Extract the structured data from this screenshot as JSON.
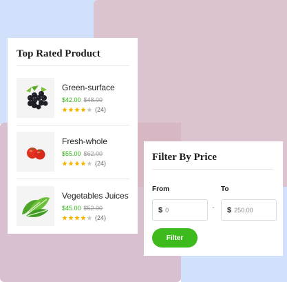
{
  "top_rated": {
    "title": "Top Rated Product",
    "products": [
      {
        "name": "Green-surface",
        "price": "$42.00",
        "old_price": "$48.00",
        "rating": 4,
        "max_rating": 5,
        "reviews": "(24)",
        "icon": "blackberry-icon"
      },
      {
        "name": "Fresh-whole",
        "price": "$55.00",
        "old_price": "$62.00",
        "rating": 4,
        "max_rating": 5,
        "reviews": "(24)",
        "icon": "tomato-icon"
      },
      {
        "name": "Vegetables Juices",
        "price": "$45.00",
        "old_price": "$52.00",
        "rating": 4,
        "max_rating": 5,
        "reviews": "(24)",
        "icon": "spinach-icon"
      }
    ]
  },
  "filter": {
    "title": "Filter By Price",
    "from_label": "From",
    "to_label": "To",
    "currency": "$",
    "from_placeholder": "0",
    "to_placeholder": "250.00",
    "separator": "-",
    "button_label": "Filter"
  },
  "colors": {
    "accent_green": "#3dba1c",
    "price_green": "#2fb814",
    "star_filled": "#f5b400",
    "star_empty": "#c8c8c8"
  }
}
